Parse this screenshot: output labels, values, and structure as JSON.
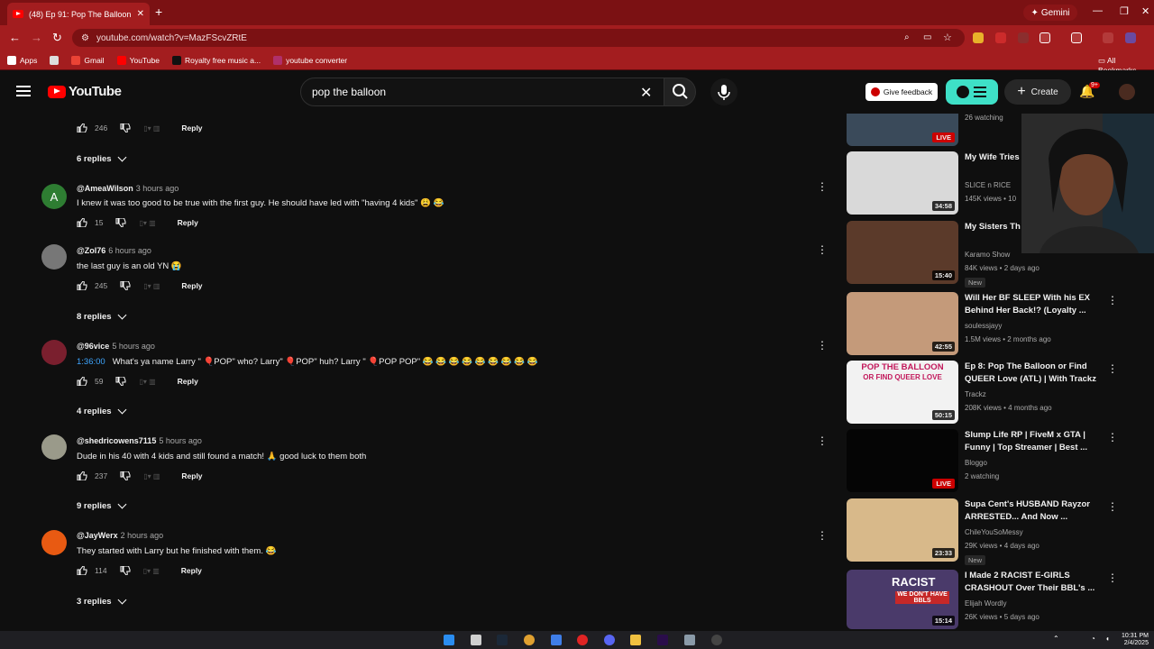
{
  "browser": {
    "tab_title": "(48) Ep 91: Pop The Balloon Or",
    "tab_close": "✕",
    "new_tab": "+",
    "gemini_label": "Gemini",
    "url": "youtube.com/watch?v=MazFScvZRtE",
    "bookmarks": [
      {
        "label": "Apps",
        "color": "#ffffff"
      },
      {
        "label": "",
        "color": "#ffffff"
      },
      {
        "label": "Gmail",
        "color": "#ea4335"
      },
      {
        "label": "YouTube",
        "color": "#ff0000"
      },
      {
        "label": "Royalty free music a...",
        "color": "#111111"
      },
      {
        "label": "youtube converter",
        "color": "#b0306a"
      }
    ],
    "all_bookmarks": "All Bookmarks"
  },
  "header": {
    "logo_text": "YouTube",
    "search_value": "pop the balloon",
    "feedback_label": "Give feedback",
    "create_label": "Create",
    "notif_count": "9+"
  },
  "comments": [
    {
      "handle": "",
      "ago": "",
      "text": "",
      "likes": "246",
      "reply": "Reply",
      "replies": "6 replies"
    },
    {
      "handle": "@AmeaWilson",
      "ago": "3 hours ago",
      "text": "I knew it was too good to be true with the first guy. He should have led with \"having 4 kids\" 😩 😂",
      "likes": "15",
      "reply": "Reply",
      "replies": "",
      "avatar_letter": "A",
      "avatar_color": "#2e7d32"
    },
    {
      "handle": "@Zol76",
      "ago": "6 hours ago",
      "text": "the last guy is an old YN 😭",
      "likes": "245",
      "reply": "Reply",
      "replies": "8 replies",
      "avatar_color": "#777777"
    },
    {
      "handle": "@96vice",
      "ago": "5 hours ago",
      "timestamp": "1:36:00",
      "text": "What's ya name Larry \" 🎈POP\" who? Larry\" 🎈POP\" huh? Larry \" 🎈POP POP\" 😂 😂 😂 😂 😂 😂 😂 😂 😂",
      "likes": "59",
      "reply": "Reply",
      "replies": "4 replies",
      "avatar_color": "#7a1f2e"
    },
    {
      "handle": "@shedricowens7115",
      "ago": "5 hours ago",
      "text": "Dude in his 40 with 4 kids and still found a match! 🙏 good luck to them both",
      "likes": "237",
      "reply": "Reply",
      "replies": "9 replies",
      "avatar_color": "#9a9a8a"
    },
    {
      "handle": "@JayWerx",
      "ago": "2 hours ago",
      "text": "They started with Larry but he finished with them. 😂",
      "likes": "114",
      "reply": "Reply",
      "replies": "3 replies",
      "avatar_color": "#e85a12"
    }
  ],
  "sidebar": [
    {
      "title": "",
      "channel": "26 watching",
      "stats": "",
      "badge": "LIVE",
      "thumb_color": "#3a4a5a"
    },
    {
      "title": "My Wife Tries Snacks",
      "channel": "SLICE n RICE",
      "stats": "145K views • 10",
      "badge": "34:58",
      "thumb_color": "#d9d9d9"
    },
    {
      "title": "My Sisters Th Drugs! | KARA",
      "channel": "Karamo Show",
      "stats": "84K views • 2 days ago",
      "badge": "15:40",
      "new": "New",
      "thumb_color": "#5b3a2a"
    },
    {
      "title": "Will Her BF SLEEP With his EX Behind Her Back!? (Loyalty ...",
      "channel": "soulessjayy",
      "stats": "1.5M views • 2 months ago",
      "badge": "42:55",
      "thumb_color": "#c49a7a"
    },
    {
      "title": "Ep 8: Pop The Balloon or Find QUEER Love (ATL) | With Trackz",
      "channel": "Trackz",
      "stats": "208K views • 4 months ago",
      "badge": "50:15",
      "thumb_color": "#f2f2f2",
      "thumb_text_1": "POP THE BALLOON",
      "thumb_text_2": "OR FIND QUEER LOVE"
    },
    {
      "title": "Slump Life RP | FiveM x GTA | Funny | Top Streamer | Best ...",
      "channel": "Bloggo",
      "stats": "2 watching",
      "badge": "LIVE",
      "thumb_color": "#050505"
    },
    {
      "title": "Supa Cent's HUSBAND Rayzor ARRESTED... And Now ...",
      "channel": "ChileYouSoMessy",
      "stats": "29K views • 4 days ago",
      "badge": "23:33",
      "new": "New",
      "thumb_color": "#d8b98a"
    },
    {
      "title": "I Made 2 RACIST E-GIRLS CRASHOUT Over Their BBL's ...",
      "channel": "Elijah Wordly",
      "stats": "26K views • 5 days ago",
      "badge": "15:14",
      "thumb_color": "#4a3a6a",
      "thumb_text_1": "RACIST",
      "thumb_text_2": "WE DON'T HAVE BBLS"
    }
  ],
  "taskbar": {
    "time": "10:31 PM",
    "date": "2/4/2025"
  },
  "colors": {
    "chrome_dark": "#7b1113",
    "chrome": "#a31d1f",
    "yt_bg": "#0f0f0f",
    "link_blue": "#3ea6ff"
  }
}
